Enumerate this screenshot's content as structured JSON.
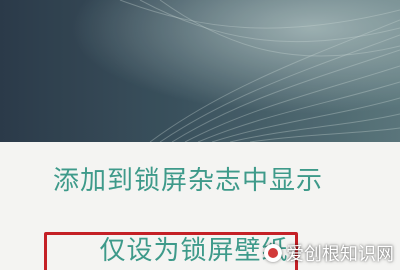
{
  "wallpaper": {
    "colors": {
      "dark": "#1c2b3a",
      "mid": "#3c5a66",
      "light": "#8aa3a6"
    }
  },
  "menu": {
    "items": [
      {
        "label": "添加到锁屏杂志中显示"
      },
      {
        "label": "仅设为锁屏壁纸"
      }
    ],
    "text_color": "#3e9a8a",
    "sheet_background": "#f4f4f2",
    "highlight_color": "#c42026"
  },
  "watermark": {
    "text": "爱创根知识网"
  }
}
